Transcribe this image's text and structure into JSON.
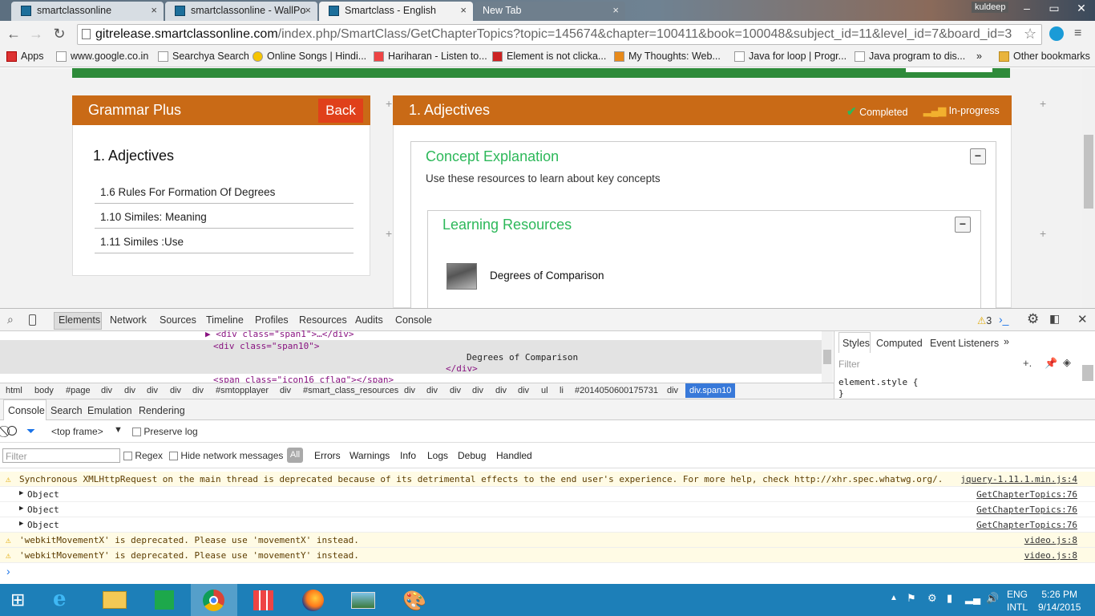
{
  "browser": {
    "tabs": [
      {
        "title": "smartclassonline",
        "close": "×"
      },
      {
        "title": "smartclassonline - WallPo",
        "close": "×"
      },
      {
        "title": "Smartclass - English",
        "close": "×"
      },
      {
        "title": "New Tab",
        "close": "×"
      }
    ],
    "profile_name": "kuldeep",
    "url_host": "gitrelease.smartclassonline.com",
    "url_path": "/index.php/SmartClass/GetChapterTopics?topic=145674&chapter=100411&book=100048&subject_id=11&level_id=7&board_id=3",
    "bookmarks": [
      "Apps",
      "www.google.co.in",
      "Searchya Search",
      "Online Songs | Hindi...",
      "Hariharan - Listen to...",
      "Element is not clicka...",
      "My Thoughts: Web...",
      "Java for loop | Progr...",
      "Java program to dis..."
    ],
    "bookmarks_overflow": "»",
    "other_bookmarks": "Other bookmarks"
  },
  "page": {
    "left_panel": {
      "title": "Grammar Plus",
      "back_label": "Back",
      "chapter": "1. Adjectives",
      "topics": [
        "1.6 Rules For Formation Of Degrees",
        "1.10 Similes: Meaning",
        "1.11 Similes :Use"
      ]
    },
    "main_panel": {
      "title": "1. Adjectives",
      "legend_completed": "Completed",
      "legend_inprogress": "In-progress",
      "concept_title": "Concept Explanation",
      "concept_desc": "Use these resources to learn about key concepts",
      "resources_title": "Learning Resources",
      "resource_name": "Degrees of Comparison",
      "collapse_symbol": "−"
    }
  },
  "devtools": {
    "tabs": [
      "Elements",
      "Network",
      "Sources",
      "Timeline",
      "Profiles",
      "Resources",
      "Audits",
      "Console"
    ],
    "warning_count": "3",
    "dom_lines": [
      "<div class=\"span1\">…</div>",
      "<div class=\"span10\">",
      "Degrees of Comparison",
      "</div>",
      "<span class=\"icon16 cflag\"></span>"
    ],
    "breadcrumbs": [
      "html",
      "body",
      "#page",
      "div",
      "div",
      "div",
      "div",
      "div",
      "#smtopplayer",
      "div",
      "#smart_class_resources",
      "div",
      "div",
      "div",
      "div",
      "div",
      "div",
      "ul",
      "li",
      "#2014050600175731",
      "div"
    ],
    "breadcrumb_active": "div.span10",
    "styles_tabs": [
      "Styles",
      "Computed",
      "Event Listeners",
      "»"
    ],
    "styles_filter_placeholder": "Filter",
    "styles_rule": "element.style {",
    "styles_rule_end": "}",
    "drawer_tabs": [
      "Console",
      "Search",
      "Emulation",
      "Rendering"
    ],
    "frame": "<top frame>",
    "preserve_log": "Preserve log",
    "filter_placeholder": "Filter",
    "regex": "Regex",
    "hide_network": "Hide network messages",
    "levels": [
      "All",
      "Errors",
      "Warnings",
      "Info",
      "Logs",
      "Debug",
      "Handled"
    ],
    "messages": [
      {
        "type": "warn",
        "text": "Synchronous XMLHttpRequest on the main thread is deprecated because of its detrimental effects to the end user's experience. For more help, check http://xhr.spec.whatwg.org/.",
        "source": "jquery-1.11.1.min.js:4"
      },
      {
        "type": "log",
        "text": "Object",
        "source": "GetChapterTopics:76"
      },
      {
        "type": "log",
        "text": "Object",
        "source": "GetChapterTopics:76"
      },
      {
        "type": "log",
        "text": "Object",
        "source": "GetChapterTopics:76"
      },
      {
        "type": "warn",
        "text": "'webkitMovementX' is deprecated. Please use 'movementX' instead.",
        "source": "video.js:8"
      },
      {
        "type": "warn",
        "text": "'webkitMovementY' is deprecated. Please use 'movementY' instead.",
        "source": "video.js:8"
      }
    ],
    "prompt": "›"
  },
  "taskbar": {
    "lang_top": "ENG",
    "lang_bottom": "INTL",
    "time": "5:26 PM",
    "date": "9/14/2015"
  }
}
